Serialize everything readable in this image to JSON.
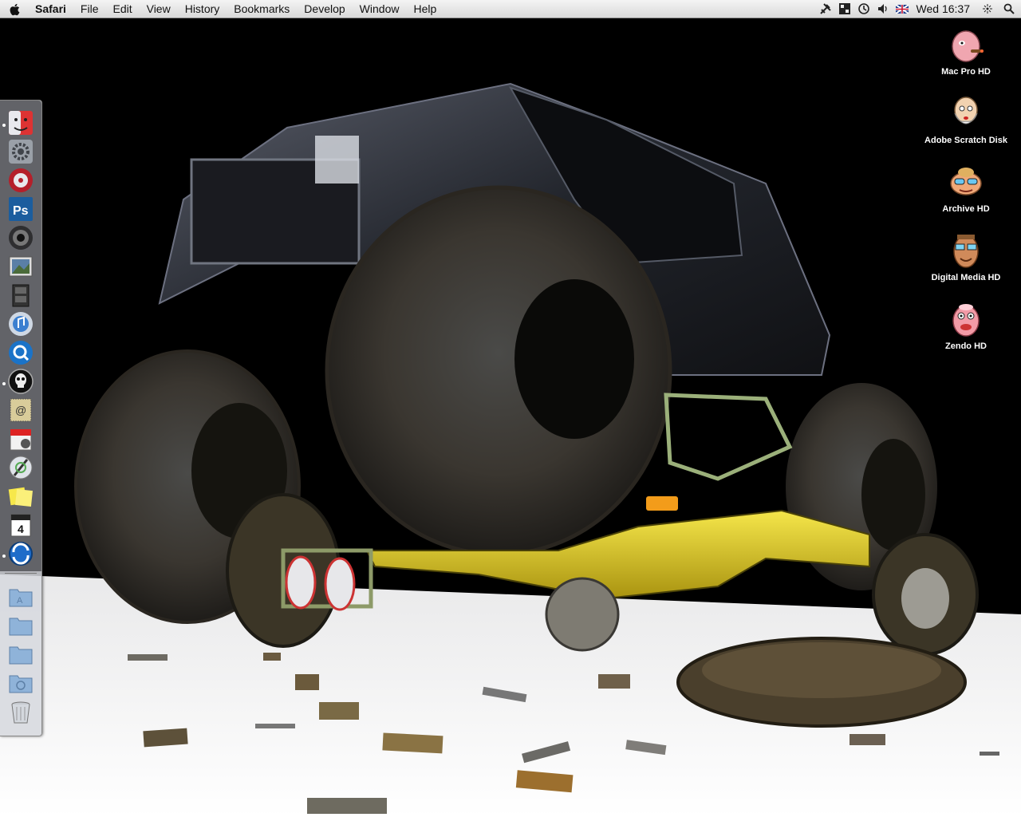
{
  "menubar": {
    "apple_icon": "apple-logo-icon",
    "app_name": "Safari",
    "menus": [
      "File",
      "Edit",
      "View",
      "History",
      "Bookmarks",
      "Develop",
      "Window",
      "Help"
    ],
    "status_icons": [
      "tools-icon",
      "spaces-icon",
      "time-machine-icon",
      "volume-icon",
      "uk-flag-input-icon"
    ],
    "clock": "Wed 16:37",
    "extra_icons": [
      "bluetooth-icon",
      "spotlight-icon"
    ]
  },
  "desktop": {
    "wallpaper": "monster-truck-crushing-buggy",
    "icons": [
      {
        "label": "Mac Pro HD",
        "icon": "cartoon-head-cigar-icon"
      },
      {
        "label": "Adobe Scratch Disk",
        "icon": "cartoon-head-beard-icon"
      },
      {
        "label": "Archive HD",
        "icon": "cartoon-head-sunglasses-icon"
      },
      {
        "label": "Digital Media HD",
        "icon": "cartoon-head-glasses-icon"
      },
      {
        "label": "Zendo HD",
        "icon": "cartoon-head-pink-icon"
      }
    ]
  },
  "dock": {
    "position": "left",
    "apps": [
      {
        "name": "finder-icon",
        "running": true
      },
      {
        "name": "system-preferences-icon",
        "running": false
      },
      {
        "name": "dvd-player-icon",
        "running": false
      },
      {
        "name": "photoshop-icon",
        "running": false,
        "text": "Ps"
      },
      {
        "name": "aperture-icon",
        "running": false
      },
      {
        "name": "preview-icon",
        "running": false
      },
      {
        "name": "imovie-icon",
        "running": false
      },
      {
        "name": "itunes-icon",
        "running": false
      },
      {
        "name": "quicktime-icon",
        "running": false
      },
      {
        "name": "punisher-skull-icon",
        "running": true
      },
      {
        "name": "mail-stamp-icon",
        "running": false
      },
      {
        "name": "ical-icon",
        "running": false
      },
      {
        "name": "script-editor-icon",
        "running": false
      },
      {
        "name": "stickies-icon",
        "running": false
      },
      {
        "name": "calendar-4-icon",
        "running": false,
        "text": "4"
      },
      {
        "name": "safari-sync-icon",
        "running": true
      }
    ],
    "stacks": [
      "applications-folder-icon",
      "documents-folder-icon",
      "downloads-folder-icon",
      "web-folder-icon",
      "trash-icon"
    ]
  }
}
